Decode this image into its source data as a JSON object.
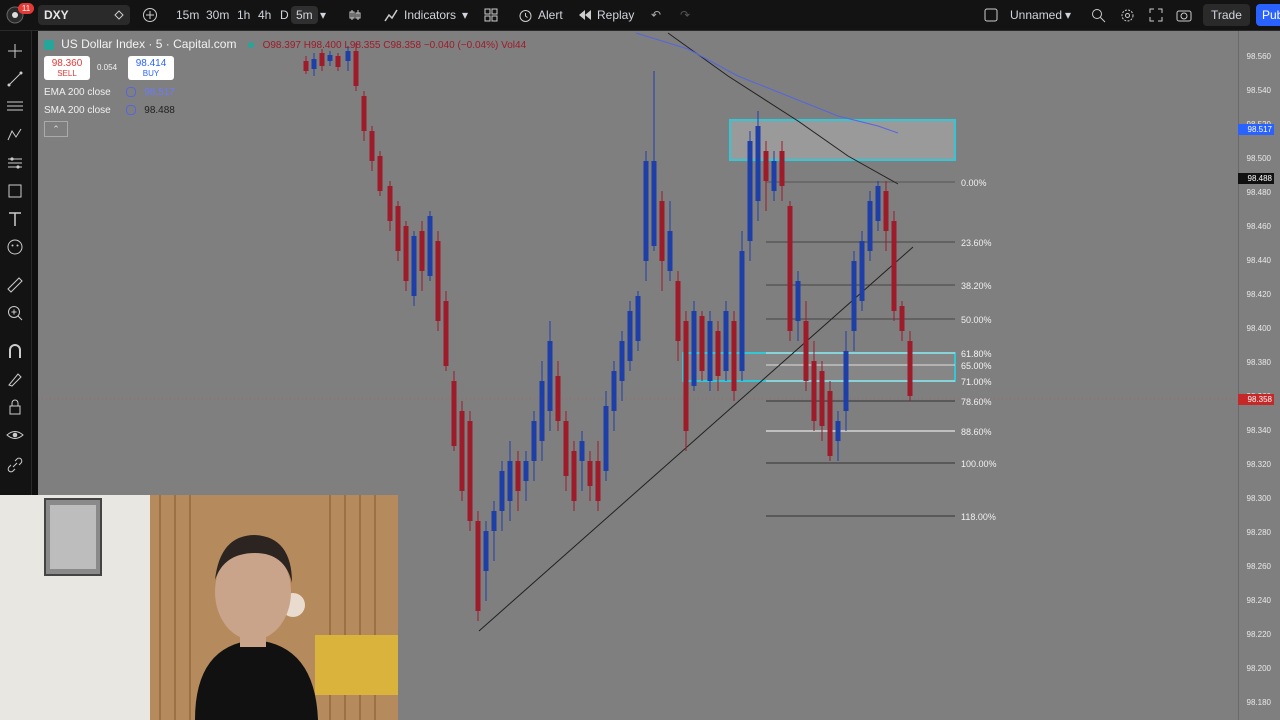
{
  "topbar": {
    "notification_count": "11",
    "symbol": "DXY",
    "timeframes": [
      "15m",
      "30m",
      "1h",
      "4h",
      "D",
      "5m"
    ],
    "indicators_label": "Indicators",
    "alert_label": "Alert",
    "replay_label": "Replay",
    "layout_name": "Unnamed",
    "trade_label": "Trade",
    "publish_label": "Pub"
  },
  "legend": {
    "title": "US Dollar Index · 5 · Capital.com",
    "ohlc": "O98.397  H98.400  L98.355  C98.358  −0.040 (−0.04%)  Vol44",
    "sell_price": "98.360",
    "sell_label": "SELL",
    "spread": "0.054",
    "buy_price": "98.414",
    "buy_label": "BUY",
    "ema_label": "EMA 200 close",
    "ema_value": "98.517",
    "sma_label": "SMA 200 close",
    "sma_value": "98.488"
  },
  "price_axis": {
    "labels": [
      "98.560",
      "98.540",
      "98.520",
      "98.500",
      "98.480",
      "98.460",
      "98.440",
      "98.420",
      "98.400",
      "98.380",
      "98.360",
      "98.340",
      "98.320",
      "98.300",
      "98.280",
      "98.260",
      "98.240",
      "98.220",
      "98.200",
      "98.180"
    ],
    "ema_tag": "98.517",
    "sma_tag": "98.488",
    "last_tag": "98.358"
  },
  "fibonacci": {
    "levels": [
      "0.00%",
      "23.60%",
      "38.20%",
      "50.00%",
      "61.80%",
      "65.00%",
      "71.00%",
      "78.60%",
      "88.60%",
      "100.00%",
      "118.00%"
    ]
  },
  "colors": {
    "background": "#7f7f7f",
    "up_candle": "#1f3fa8",
    "down_candle": "#9e1b2a",
    "zone_border": "#33c6d6",
    "ema_line": "#5566dd",
    "last_price_tag": "#c62828",
    "ema_tag": "#2962ff"
  },
  "chart_data": {
    "type": "candlestick",
    "title": "US Dollar Index · 5 · Capital.com",
    "ylim": [
      98.17,
      98.575
    ],
    "ohlc_last": {
      "open": 98.397,
      "high": 98.4,
      "low": 98.355,
      "close": 98.358
    },
    "indicators": [
      {
        "name": "EMA 200 close",
        "value": 98.517
      },
      {
        "name": "SMA 200 close",
        "value": 98.488
      }
    ]
  }
}
